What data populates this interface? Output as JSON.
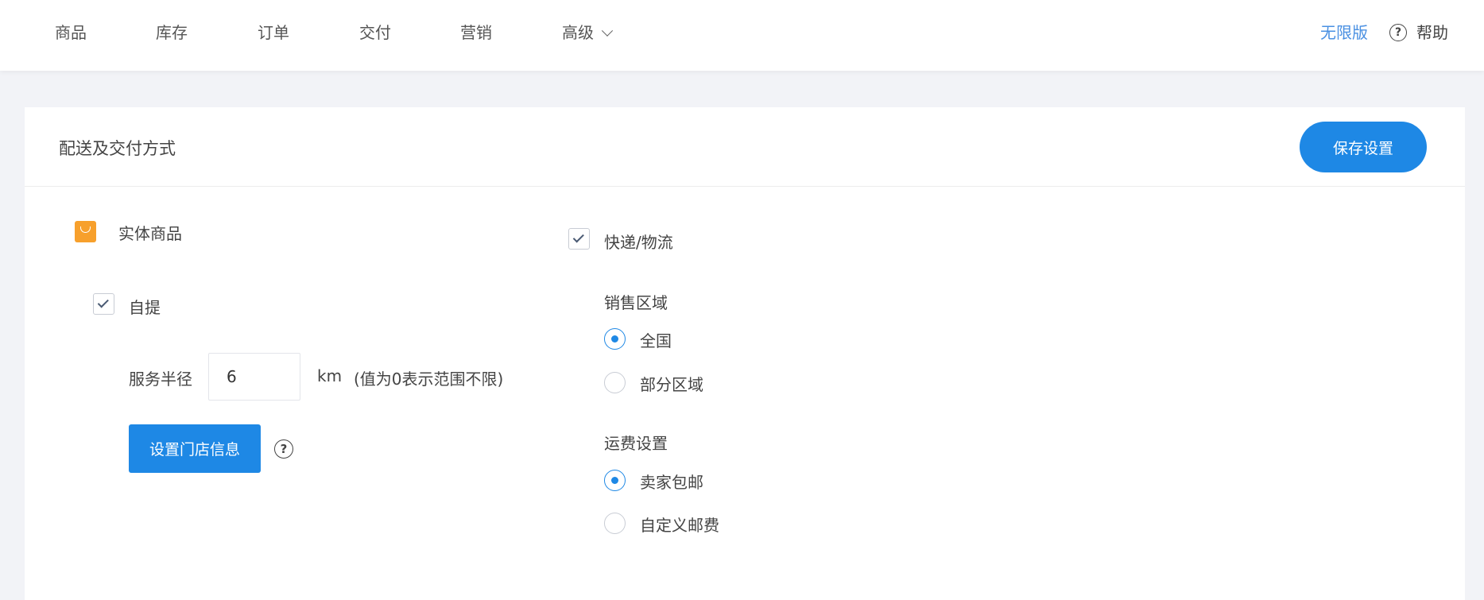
{
  "nav": {
    "items": [
      {
        "label": "商品"
      },
      {
        "label": "库存"
      },
      {
        "label": "订单"
      },
      {
        "label": "交付"
      },
      {
        "label": "营销"
      },
      {
        "label": "高级"
      }
    ],
    "edition": "无限版",
    "help": "帮助"
  },
  "card": {
    "title": "配送及交付方式",
    "save_label": "保存设置"
  },
  "physical": {
    "label": "实体商品",
    "icon": "shopping-bag-icon",
    "icon_color": "#f7a02c"
  },
  "pickup": {
    "label": "自提",
    "checked": true,
    "radius_label": "服务半径",
    "radius_value": "6",
    "radius_unit": "km",
    "radius_hint": "(值为0表示范围不限)",
    "store_button": "设置门店信息"
  },
  "express": {
    "label": "快递/物流",
    "checked": true,
    "sales_area": {
      "title": "销售区域",
      "options": [
        "全国",
        "部分区域"
      ],
      "selected": "全国"
    },
    "shipping": {
      "title": "运费设置",
      "options": [
        "卖家包邮",
        "自定义邮费"
      ],
      "selected": "卖家包邮"
    }
  },
  "colors": {
    "primary": "#1e88e5",
    "link": "#4a90e2",
    "background": "#f2f3f7"
  }
}
